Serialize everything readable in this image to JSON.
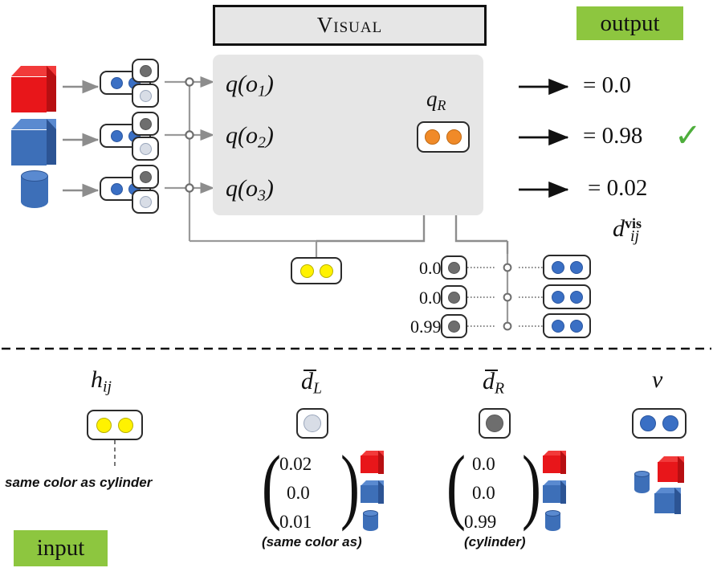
{
  "figure": {
    "module_title": "Visual",
    "output_badge": "output",
    "input_badge": "input"
  },
  "colors": {
    "red": "#e8161a",
    "red_dark": "#b70f12",
    "red_top": "#f23a3a",
    "blue": "#3d6fb8",
    "blue_dark": "#2c5494",
    "blue_top": "#5a8ad0",
    "dot_blue": "#3a6fc4",
    "dot_blue_border": "#2a56a0",
    "dot_grey_dark": "#6e6e6e",
    "dot_grey_light": "#d8dde6",
    "dot_orange": "#f08a28",
    "dot_orange_border": "#c06a14",
    "dot_yellow": "#fff200",
    "dot_yellow_border": "#b8b000",
    "panel_grey": "#e6e6e6",
    "green_badge": "#8dc63f",
    "check_green": "#4eae3c",
    "line_grey": "#9a9a9a",
    "line_dark": "#555555",
    "box_stroke": "#2b2b2b"
  },
  "objects": [
    {
      "id": "o1",
      "shape": "cube",
      "color_name": "red"
    },
    {
      "id": "o2",
      "shape": "cube",
      "color_name": "blue"
    },
    {
      "id": "o3",
      "shape": "cylinder",
      "color_name": "blue"
    }
  ],
  "visual_module": {
    "q_nodes": [
      {
        "label_base": "q(o",
        "index": "1",
        "label_close": ")"
      },
      {
        "label_base": "q(o",
        "index": "2",
        "label_close": ")"
      },
      {
        "label_base": "q(o",
        "index": "3",
        "label_close": ")"
      }
    ],
    "qR_label_base": "q",
    "qR_label_sub": "R",
    "qR_capsule_dots": [
      "orange",
      "orange"
    ]
  },
  "outputs": [
    {
      "equals": "= 0.0",
      "correct": false
    },
    {
      "equals": "= 0.98",
      "correct": true,
      "check": "✓"
    },
    {
      "equals": "= 0.02",
      "correct": false
    }
  ],
  "output_symbol": {
    "base": "d",
    "sub": "ij",
    "sup": "vis"
  },
  "h_capsule": {
    "dots": [
      "yellow",
      "yellow"
    ]
  },
  "attention_rows": [
    {
      "weight": "0.0",
      "left_dot": "grey_dark",
      "right_dots": [
        "blue",
        "blue"
      ]
    },
    {
      "weight": "0.0",
      "left_dot": "grey_dark",
      "right_dots": [
        "blue",
        "blue"
      ]
    },
    {
      "weight": "0.99",
      "left_dot": "grey_dark",
      "right_dots": [
        "blue",
        "blue"
      ]
    }
  ],
  "legend": {
    "columns": [
      {
        "symbol_base": "h",
        "symbol_sub": "ij",
        "overbar": false,
        "capsule_dots": [
          "yellow",
          "yellow"
        ],
        "caption": "same color as cylinder",
        "caption_position": "below-dashed",
        "vector": null,
        "vector_shapes": null,
        "bottom_caption": null
      },
      {
        "symbol_base": "d",
        "symbol_sub": "L",
        "overbar": true,
        "capsule_dots": [
          "grey_light"
        ],
        "caption": null,
        "vector": [
          "0.02",
          "0.0",
          "0.01"
        ],
        "vector_shapes": [
          "red-cube",
          "blue-cube",
          "blue-cylinder"
        ],
        "bottom_caption": "(same color as)"
      },
      {
        "symbol_base": "d",
        "symbol_sub": "R",
        "overbar": true,
        "capsule_dots": [
          "grey_dark"
        ],
        "caption": null,
        "vector": [
          "0.0",
          "0.0",
          "0.99"
        ],
        "vector_shapes": [
          "red-cube",
          "blue-cube",
          "blue-cylinder"
        ],
        "bottom_caption": "(cylinder)"
      },
      {
        "symbol_base": "v",
        "symbol_sub": "",
        "overbar": false,
        "capsule_dots": [
          "blue",
          "blue"
        ],
        "caption": null,
        "vector": null,
        "vector_shapes": [
          "blue-cylinder",
          "red-cube",
          "blue-cube"
        ],
        "bottom_caption": null
      }
    ]
  }
}
